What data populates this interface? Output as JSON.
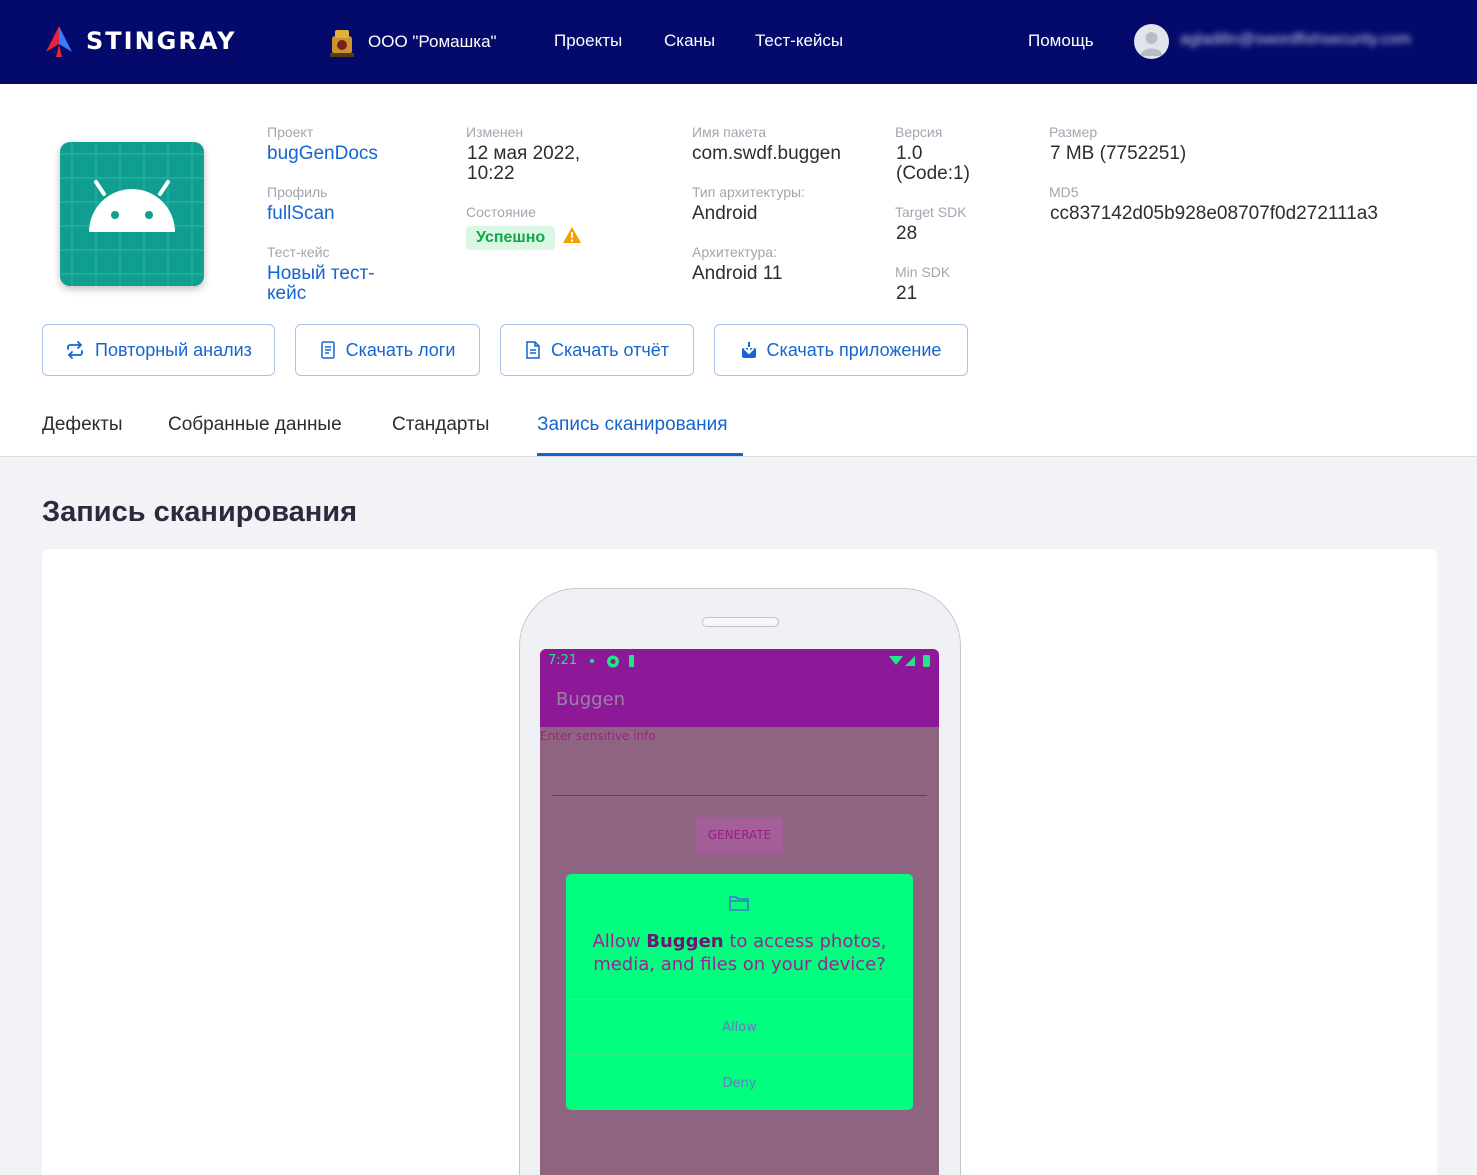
{
  "header": {
    "brand": "STINGRAY",
    "org": "ООО \"Ромашка\"",
    "nav": [
      "Проекты",
      "Сканы",
      "Тест-кейсы"
    ],
    "help": "Помощь",
    "email": "agladilin@swordfishsecurity.com"
  },
  "app": {
    "project_label": "Проект",
    "project": "bugGenDocs",
    "profile_label": "Профиль",
    "profile": "fullScan",
    "testcase_label": "Тест-кейс",
    "testcase_line1": "Новый тест-",
    "testcase_line2": "кейс",
    "modified_label": "Изменен",
    "modified_line1": "12 мая 2022,",
    "modified_line2": "10:22",
    "state_label": "Состояние",
    "state": "Успешно",
    "package_label": "Имя пакета",
    "package": "com.swdf.buggen",
    "arch_type_label": "Тип архитектуры:",
    "arch_type": "Android",
    "arch_label": "Архитектура:",
    "arch": "Android 11",
    "version_label": "Версия",
    "version_line1": "1.0",
    "version_line2": "(Code:1)",
    "target_sdk_label": "Target SDK",
    "target_sdk": "28",
    "min_sdk_label": "Min SDK",
    "min_sdk": "21",
    "size_label": "Размер",
    "size": "7 MB (7752251)",
    "md5_label": "MD5",
    "md5": "cc837142d05b928e08707f0d272111a3"
  },
  "actions": {
    "reanalyze": "Повторный анализ",
    "logs": "Скачать логи",
    "report": "Скачать отчёт",
    "app": "Скачать приложение"
  },
  "tabs": [
    "Дефекты",
    "Собранные данные",
    "Стандарты",
    "Запись сканирования"
  ],
  "section_title": "Запись сканирования",
  "device": {
    "time": "7:21",
    "app_title": "Buggen",
    "hint": "Enter sensitive info",
    "generate": "GENERATE",
    "dialog_pre": "Allow ",
    "dialog_app": "Buggen",
    "dialog_post": " to access photos, media, and files on your device?",
    "allow": "Allow",
    "deny": "Deny"
  },
  "colors": {
    "navbar": "#030a6b",
    "accent": "#1565d0",
    "success": "#11a84a",
    "warning": "#f5a000",
    "device_primary": "#8d1898",
    "dialog": "#00ff7e"
  }
}
